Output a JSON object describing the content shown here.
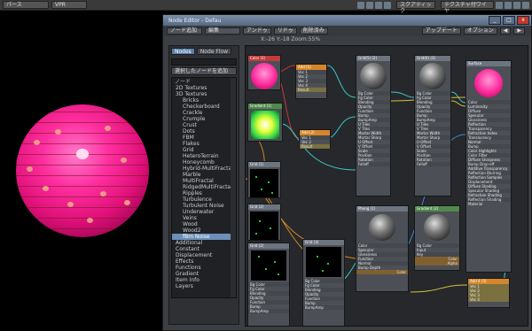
{
  "viewport": {
    "view_select": "パース",
    "shading_select": "VPR",
    "right_select": "スクアティック",
    "right_select2": "テクスチャ付ワイヤ"
  },
  "window": {
    "title": "Node Editor - Defau",
    "buttons": [
      "_",
      "□",
      "x"
    ]
  },
  "toolbar": {
    "add_node": "ノード追加",
    "edit": "編集",
    "undo": "アンドゥ",
    "redo": "リドゥ",
    "delete": "削除済み",
    "update": "アップデート",
    "options": "オプション",
    "zoom_text": "X:-26  Y:-18  Zoom:55%"
  },
  "panel": {
    "tabs": [
      "Nodes",
      "Node Flow"
    ],
    "add_selected": "選択したノードを追加",
    "tree_head": "ノード",
    "items": [
      {
        "label": "2D Textures",
        "child": false
      },
      {
        "label": "3D Textures",
        "child": false
      },
      {
        "label": "Bricks",
        "child": true
      },
      {
        "label": "Checkerboard",
        "child": true
      },
      {
        "label": "Crackle",
        "child": true
      },
      {
        "label": "Crumple",
        "child": true
      },
      {
        "label": "Crust",
        "child": true
      },
      {
        "label": "Dots",
        "child": true
      },
      {
        "label": "FBM",
        "child": true
      },
      {
        "label": "Flakes",
        "child": true
      },
      {
        "label": "Grid",
        "child": true
      },
      {
        "label": "HeteroTerrain",
        "child": true
      },
      {
        "label": "Honeycomb",
        "child": true
      },
      {
        "label": "Hybrid-MultiFractal",
        "child": true
      },
      {
        "label": "Marble",
        "child": true
      },
      {
        "label": "MultiFractal",
        "child": true
      },
      {
        "label": "RidgedMultiFractal",
        "child": true
      },
      {
        "label": "Ripples",
        "child": true
      },
      {
        "label": "Turbulence",
        "child": true
      },
      {
        "label": "Turbulent Noise",
        "child": true
      },
      {
        "label": "Underwater",
        "child": true
      },
      {
        "label": "Veins",
        "child": true
      },
      {
        "label": "Wood",
        "child": true
      },
      {
        "label": "Wood2",
        "child": true
      },
      {
        "label": "fBm Noise",
        "child": true,
        "selected": true
      },
      {
        "label": "Additional",
        "child": false
      },
      {
        "label": "Constant",
        "child": false
      },
      {
        "label": "Displacement",
        "child": false
      },
      {
        "label": "Effects",
        "child": false
      },
      {
        "label": "Functions",
        "child": false
      },
      {
        "label": "Gradient",
        "child": false
      },
      {
        "label": "Item Info",
        "child": false
      },
      {
        "label": "Layers",
        "child": false
      }
    ]
  },
  "nodes": {
    "color_title": "Color (1)",
    "gradient_title": "Gradient (1)",
    "add1": {
      "title": "Add (1)",
      "ports": [
        "Vec 1",
        "Vec 2",
        "Vec 3",
        "Vec 4",
        "Result"
      ]
    },
    "add2": {
      "title": "Add (2)",
      "ports": [
        "Vec 1",
        "Vec 2",
        "Result"
      ]
    },
    "grid1_title": "Grid (1)",
    "grid2_title": "Grid (2)",
    "grid3_title": "Grid (3)",
    "grid4_title": "Grid (4)",
    "grid5": {
      "title": "Grid(5) (2)",
      "ports": [
        "Bg Color",
        "Fg Color",
        "Blending",
        "Opacity",
        "Function",
        "Bump",
        "BumpAmp",
        "U Tiles",
        "V Tiles",
        "Mortar Width",
        "Mortar Sharp",
        "U Offset",
        "V Offset",
        "Scale",
        "Position",
        "Rotation",
        "Falloff"
      ]
    },
    "grid6": {
      "title": "Grid(6) (3)",
      "ports": [
        "Bg Color",
        "Fg Color",
        "Blending",
        "Opacity",
        "Function",
        "Bump",
        "BumpAmp",
        "U Tiles",
        "V Tiles",
        "Mortar Width",
        "Mortar Sharp",
        "U Offset",
        "V Offset",
        "Scale",
        "Position",
        "Rotation",
        "Falloff"
      ]
    },
    "grid_low1": {
      "title": "Grid (2)",
      "ports": [
        "Bg Color",
        "Fg Color",
        "Blending",
        "Opacity",
        "Function",
        "Bump",
        "BumpAmp"
      ]
    },
    "grid_low2": {
      "title": "Grid (3)",
      "ports": [
        "Bg Color",
        "Fg Color",
        "Blending",
        "Opacity",
        "Function",
        "Bump",
        "BumpAmp"
      ]
    },
    "phong": {
      "title": "Phong (1)",
      "ports": [
        "Color",
        "Specular",
        "Glossiness",
        "Function",
        "Normal",
        "Bump Depth"
      ],
      "outputs": [
        "Color"
      ]
    },
    "gradient2": {
      "title": "Gradient (2)",
      "ports": [
        "Bg Color",
        "Input",
        "Key"
      ],
      "outputs": [
        "Color",
        "Alpha"
      ]
    },
    "add4": {
      "title": "Add 4 (3)",
      "ports": [
        "Vec 1",
        "Vec 2",
        "Vec 3",
        "Vec 4"
      ]
    },
    "surface": {
      "title": "Surface",
      "ports": [
        "Color",
        "Luminosity",
        "Diffuse",
        "Specular",
        "Glossiness",
        "Reflection",
        "Transparency",
        "Refraction Index",
        "Translucency",
        "Normal",
        "Bump",
        "Color Highlights",
        "Color Filter",
        "Diffuse Sharpness",
        "Bump Drop-off",
        "Additive Transparency",
        "Reflection Blurring",
        "Reflection Samples",
        "Displacement",
        "Diffuse Shading",
        "Specular Shading",
        "Refraction Shading",
        "Reflection Shading",
        "Material"
      ]
    }
  }
}
